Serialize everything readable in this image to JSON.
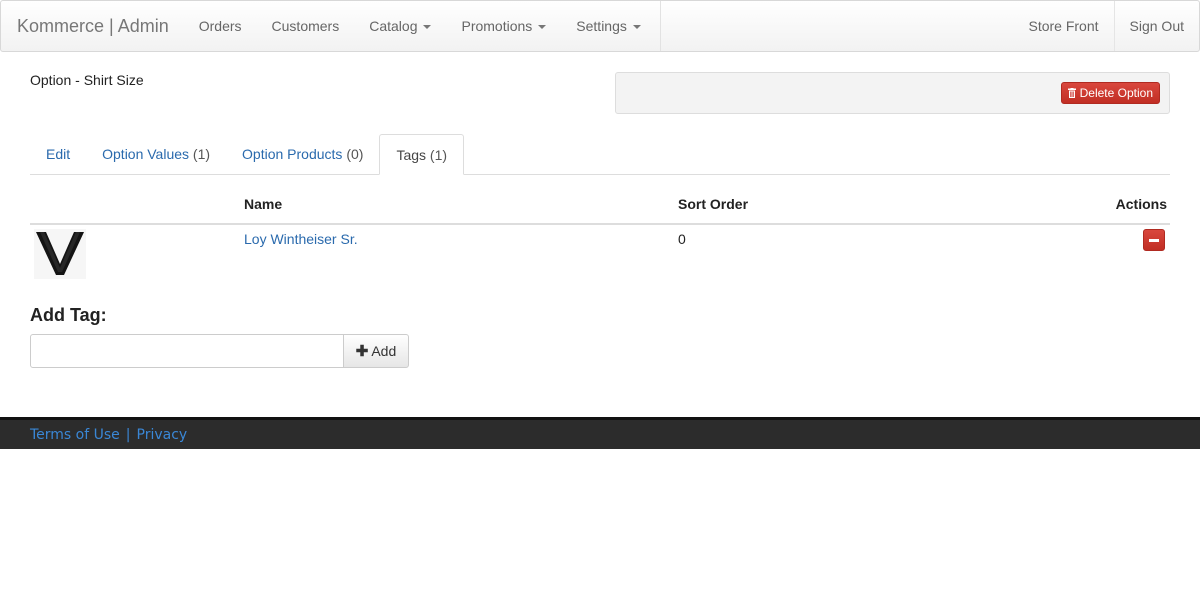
{
  "navbar": {
    "brand": "Kommerce | Admin",
    "items": [
      {
        "label": "Orders",
        "dropdown": false
      },
      {
        "label": "Customers",
        "dropdown": false
      },
      {
        "label": "Catalog",
        "dropdown": true
      },
      {
        "label": "Promotions",
        "dropdown": true
      },
      {
        "label": "Settings",
        "dropdown": true
      }
    ],
    "right_items": [
      {
        "label": "Store Front"
      },
      {
        "label": "Sign Out"
      }
    ]
  },
  "header": {
    "title": "Option - Shirt Size",
    "delete_button": "Delete Option",
    "delete_icon": "trash-icon",
    "danger_color": "#c9302c"
  },
  "tabs": [
    {
      "label": "Edit",
      "count": ""
    },
    {
      "label": "Option Values",
      "count": "(1)"
    },
    {
      "label": "Option Products",
      "count": "(0)"
    },
    {
      "label": "Tags",
      "count": "(1)",
      "active": true
    }
  ],
  "table": {
    "columns": {
      "name": "Name",
      "sort_order": "Sort Order",
      "actions": "Actions"
    },
    "rows": [
      {
        "name": "Loy Wintheiser Sr.",
        "sort_order": "0",
        "action_icon": "minus-icon"
      }
    ]
  },
  "add_tag": {
    "label": "Add Tag:",
    "input_value": "",
    "button_label": "Add",
    "button_icon": "plus-icon"
  },
  "footer": {
    "terms": "Terms of Use",
    "separator": "|",
    "privacy": "Privacy"
  },
  "colors": {
    "link": "#2a6aad",
    "footer_bg": "#2c2c2c"
  }
}
